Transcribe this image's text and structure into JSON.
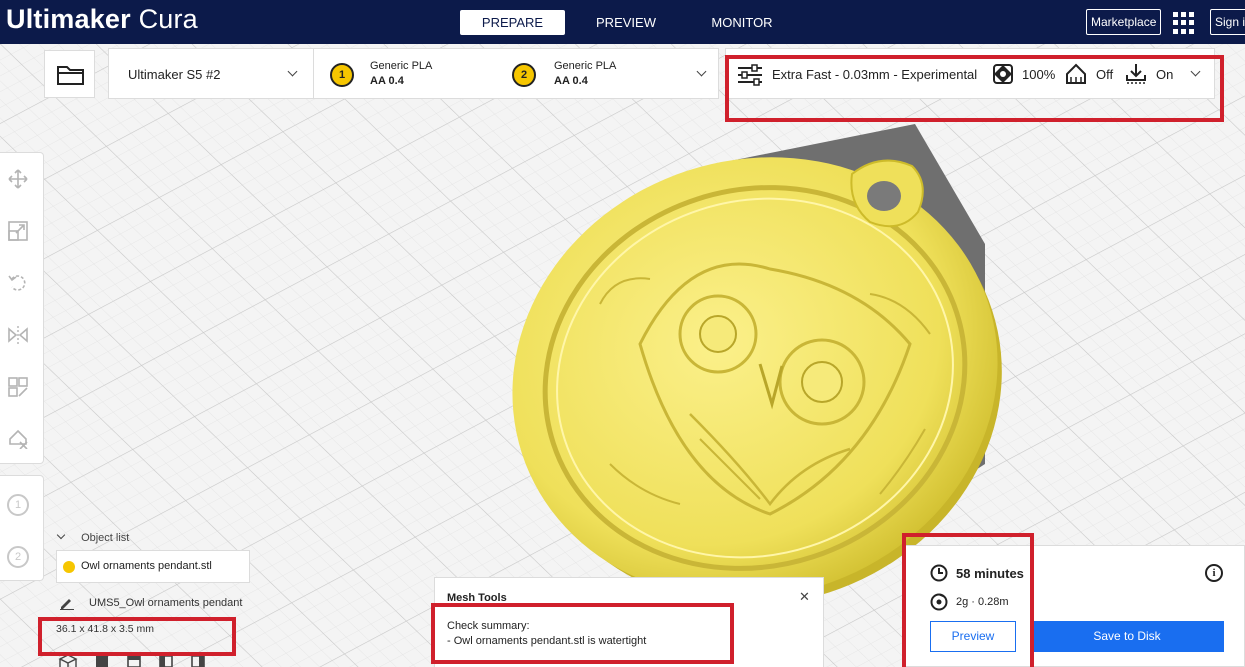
{
  "app": {
    "brand_bold": "Ultimaker",
    "brand_light": "Cura",
    "stages": [
      {
        "label": "PREPARE"
      },
      {
        "label": "PREVIEW"
      },
      {
        "label": "MONITOR"
      }
    ],
    "marketplace_label": "Marketplace",
    "signin_label": "Sign in"
  },
  "toolbar": {
    "printer_name": "Ultimaker S5 #2",
    "extruders": [
      {
        "number": "1",
        "material": "Generic PLA",
        "nozzle": "AA 0.4"
      },
      {
        "number": "2",
        "material": "Generic PLA",
        "nozzle": "AA 0.4"
      }
    ],
    "print_settings": {
      "profile": "Extra Fast - 0.03mm - Experimental",
      "infill": "100%",
      "support": "Off",
      "adhesion": "On"
    }
  },
  "tools": [
    "move-icon",
    "scale-icon",
    "rotate-icon",
    "mirror-icon",
    "per-model-settings-icon",
    "support-blocker-icon"
  ],
  "extruder_buttons": [
    "1",
    "2"
  ],
  "object_list": {
    "header": "Object list",
    "items": [
      {
        "name": "Owl ornaments pendant.stl"
      }
    ],
    "job_name": "UMS5_Owl ornaments pendant",
    "dimensions": "36.1 x 41.8 x 3.5 mm"
  },
  "mesh_tools": {
    "title": "Mesh Tools",
    "summary_heading": "Check summary:",
    "summary_line": "- Owl ornaments pendant.stl is watertight",
    "close_glyph": "✕"
  },
  "print_job": {
    "time": "58 minutes",
    "material": "2g · 0.28m",
    "preview_label": "Preview",
    "save_label": "Save to Disk",
    "info_glyph": "i"
  },
  "colors": {
    "header_bg": "#0c1a4a",
    "accent_blue": "#196ef0",
    "model_yellow": "#f2e25a",
    "highlight_red": "#d0202c"
  }
}
